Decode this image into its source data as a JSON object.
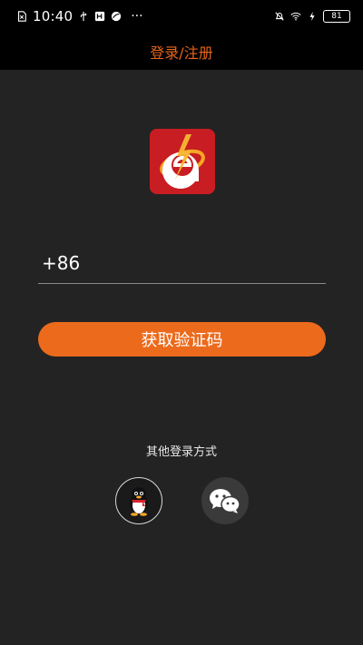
{
  "status_bar": {
    "time": "10:40",
    "dots": "···",
    "battery": "81"
  },
  "header": {
    "title": "登录/注册"
  },
  "form": {
    "country_code": "+86",
    "phone_value": "",
    "phone_placeholder": "",
    "get_code_label": "获取验证码"
  },
  "other_login": {
    "label": "其他登录方式",
    "options": [
      {
        "name": "qq",
        "icon": "qq-penguin-icon"
      },
      {
        "name": "wechat",
        "icon": "wechat-icon"
      }
    ]
  },
  "colors": {
    "accent": "#ec6a1c",
    "background": "#232323",
    "header": "#000000",
    "logo": "#c81d22"
  }
}
